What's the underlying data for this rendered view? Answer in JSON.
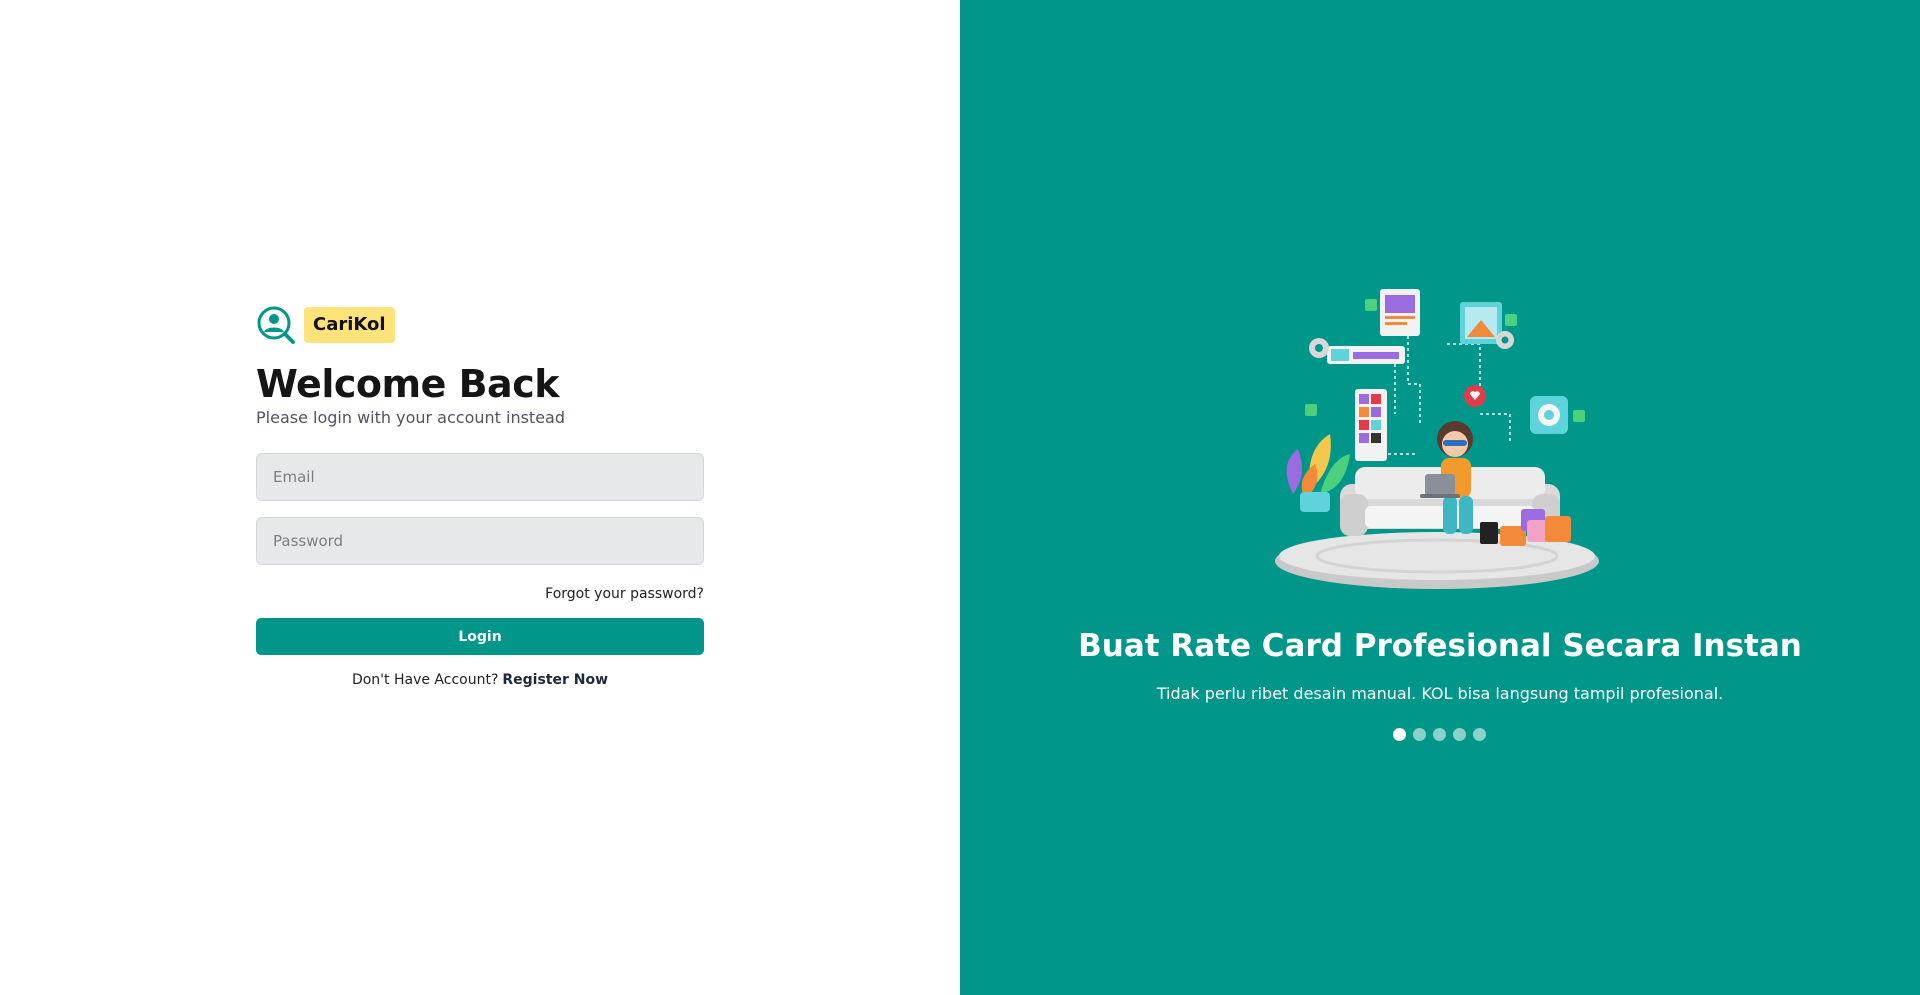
{
  "brand": {
    "name": "CariKol",
    "accent": "#00978a",
    "badge_color": "#ffe37a"
  },
  "login": {
    "title": "Welcome Back",
    "subtitle": "Please login with your account instead",
    "email": {
      "value": "",
      "placeholder": "Email"
    },
    "password": {
      "value": "",
      "placeholder": "Password"
    },
    "forgot_label": "Forgot your password?",
    "submit_label": "Login",
    "register_prompt": "Don't Have Account?",
    "register_label": "Register Now"
  },
  "promo": {
    "title": "Buat Rate Card Profesional Secara Instan",
    "subtitle": "Tidak perlu ribet desain manual. KOL bisa langsung tampil profesional.",
    "illustration_icon": "person-with-laptop-on-sofa-illustration",
    "slide_count": 5,
    "active_slide": 1
  }
}
